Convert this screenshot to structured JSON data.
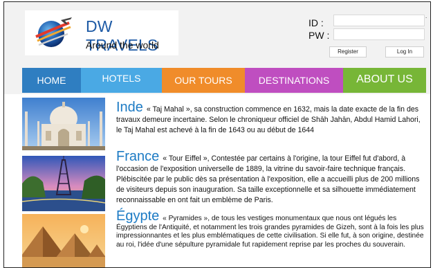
{
  "brand": {
    "name": "DW TRAVELS",
    "tagline": "Around the world"
  },
  "login": {
    "id_label": "ID :",
    "pw_label": "PW :",
    "id_value": "",
    "pw_value": "",
    "register_label": "Register",
    "login_label": "Log In"
  },
  "nav": {
    "items": [
      {
        "label": "HOME",
        "color": "#2f7ec1"
      },
      {
        "label": "HOTELS",
        "color": "#4aa9e4"
      },
      {
        "label": "OUR TOURS",
        "color": "#f08c2a"
      },
      {
        "label": "DESTINATIONS",
        "color": "#bf4ec0"
      },
      {
        "label": "ABOUT US",
        "color": "#77b637"
      }
    ]
  },
  "sections": [
    {
      "country": "Inde",
      "text": "« Taj Mahal », sa construction commence en 1632, mais la date exacte de la fin des travaux demeure incertaine. Selon le chroniqueur officiel de Shāh Jahān, Abdul Hamid Lahori, le Taj Mahal est achevé à la fin de 1643 ou au début de 1644"
    },
    {
      "country": "France",
      "text": "« Tour Eiffel », Contestée par certains à l'origine, la tour Eiffel fut d'abord, à l'occasion de l'exposition universelle de 1889, la vitrine du savoir-faire technique français. Plébiscitée par le public dès sa présentation à l'exposition, elle a accueilli plus de 200 millions de visiteurs depuis son inauguration. Sa taille exceptionnelle et sa silhouette immédiatement reconnaissable en ont fait un emblème de Paris."
    },
    {
      "country": "Égypte",
      "text": "« Pyramides », de tous les vestiges monumentaux que nous ont légués les Égyptiens de l'Antiquité, et notamment les trois grandes pyramides de Gizeh, sont à la fois les plus impressionnantes et les plus emblématiques de cette civilisation. Si elle fut, à son origine, destinée au roi, l'idée d'une sépulture pyramidale fut rapidement reprise par les proches du souverain."
    }
  ]
}
